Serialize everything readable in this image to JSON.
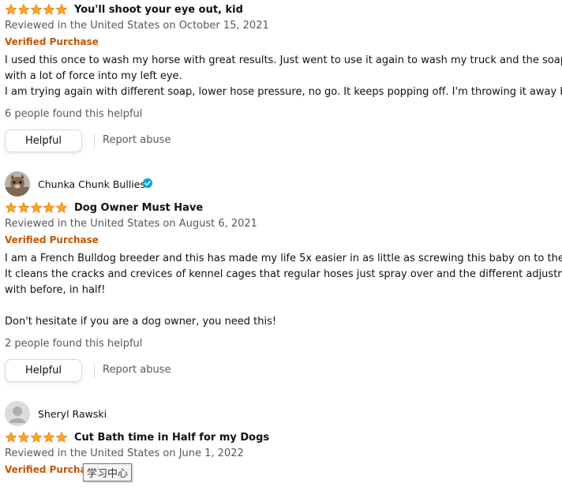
{
  "reviews": [
    {
      "rating": 5,
      "title": "You'll shoot your eye out, kid",
      "meta": "Reviewed in the United States on October 15, 2021",
      "verified": "Verified Purchase",
      "body": [
        "I used this once to wash my horse with great results. Just went to use it again to wash my truck and the soap co",
        "with a lot of force into my left eye.",
        "I am trying again with different soap, lower hose pressure, no go. It keeps popping off. I'm throwing it away beca"
      ],
      "helpful_count": "6 people found this helpful",
      "helpful_label": "Helpful",
      "report_label": "Report abuse"
    },
    {
      "reviewer": "Chunka Chunk Bullies",
      "rating": 5,
      "title": "Dog Owner Must Have",
      "meta": "Reviewed in the United States on August 6, 2021",
      "verified": "Verified Purchase",
      "body": [
        "I am a French Bulldog breeder and this has made my life 5x easier in as little as screwing this baby on to the hos",
        "It cleans the cracks and crevices of kennel cages that regular hoses just spray over and the different adjustments",
        "with before, in half!",
        "",
        "Don't hesitate if you are a dog owner, you need this!"
      ],
      "helpful_count": "2 people found this helpful",
      "helpful_label": "Helpful",
      "report_label": "Report abuse"
    },
    {
      "reviewer": "Sheryl Rawski",
      "rating": 5,
      "title": "Cut Bath time in Half for my Dogs",
      "meta": "Reviewed in the United States on June 1, 2022",
      "verified": "Verified Purchase"
    }
  ],
  "tooltip": "学习中心",
  "colors": {
    "star": "#ffa41c",
    "verified": "#c45500",
    "badge": "#00a8e1"
  }
}
